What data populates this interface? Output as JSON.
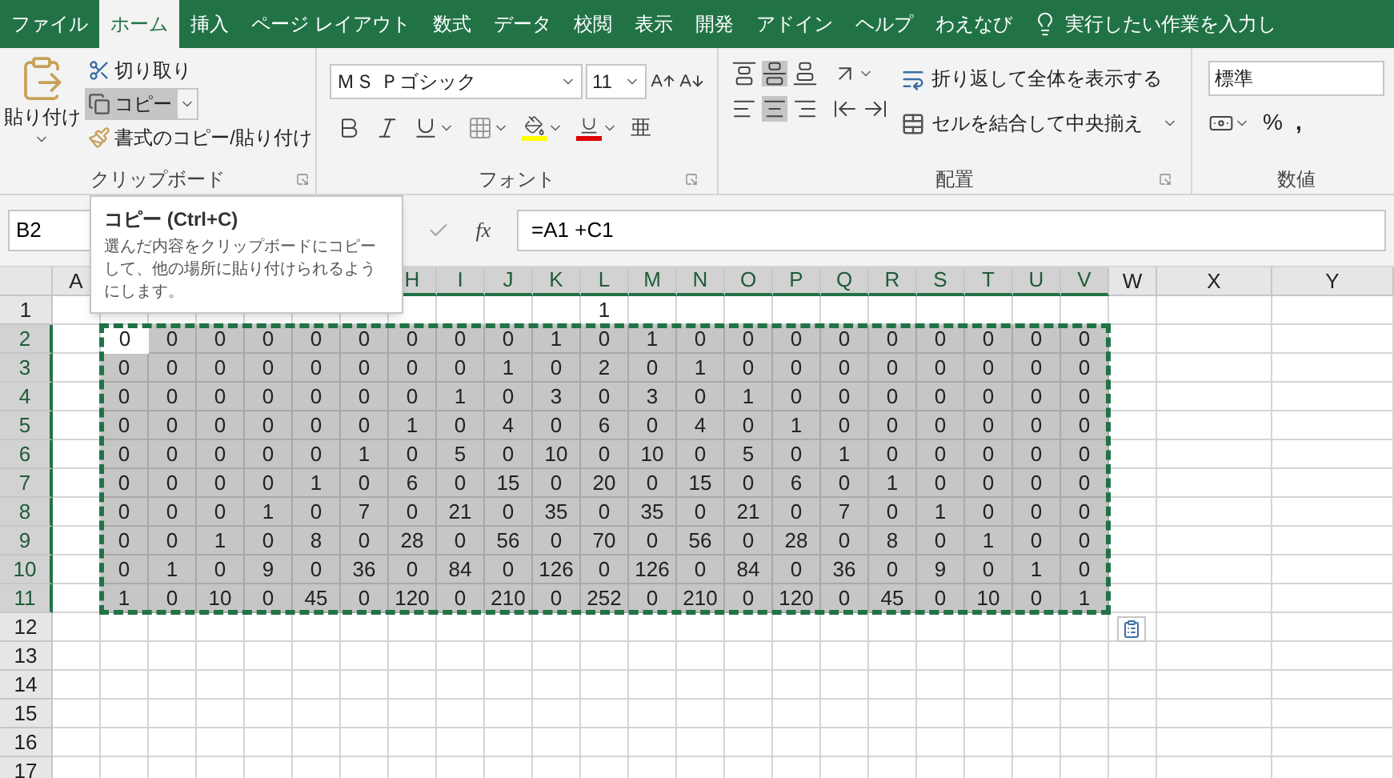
{
  "ribbon_tabs": [
    {
      "label": "ファイル",
      "selected": false
    },
    {
      "label": "ホーム",
      "selected": true
    },
    {
      "label": "挿入",
      "selected": false
    },
    {
      "label": "ページ レイアウト",
      "selected": false
    },
    {
      "label": "数式",
      "selected": false
    },
    {
      "label": "データ",
      "selected": false
    },
    {
      "label": "校閲",
      "selected": false
    },
    {
      "label": "表示",
      "selected": false
    },
    {
      "label": "開発",
      "selected": false
    },
    {
      "label": "アドイン",
      "selected": false
    },
    {
      "label": "ヘルプ",
      "selected": false
    },
    {
      "label": "わえなび",
      "selected": false
    }
  ],
  "tell_me": {
    "placeholder": "実行したい作業を入力し"
  },
  "clipboard": {
    "paste": "貼り付け",
    "cut": "切り取り",
    "copy": {
      "label": "コピー",
      "selected": true
    },
    "format_painter": "書式のコピー/貼り付け",
    "group_label": "クリップボード"
  },
  "font": {
    "name": "ＭＳ Ｐゴシック",
    "size": "11",
    "phonetic": "亜",
    "group_label": "フォント"
  },
  "alignment": {
    "wrap": "折り返して全体を表示する",
    "merge": "セルを結合して中央揃え",
    "group_label": "配置"
  },
  "number": {
    "format": "標準",
    "percent": "%",
    "comma": ",",
    "group_label": "数値"
  },
  "formula_bar": {
    "name_box": "B2",
    "fx": "fx",
    "formula": "=A1 +C1"
  },
  "tooltip": {
    "title": "コピー (Ctrl+C)",
    "body": "選んだ内容をクリップボードにコピーして、他の場所に貼り付けられるようにします。"
  },
  "sheet": {
    "columns": [
      {
        "letter": "A",
        "selected": false,
        "active": false
      },
      {
        "selected": true,
        "active": true
      },
      {
        "selected": true,
        "active": false
      },
      {
        "selected": true,
        "active": false
      },
      {
        "selected": true,
        "active": false
      },
      {
        "selected": true,
        "active": false
      },
      {
        "selected": true,
        "active": false
      },
      {
        "letter": "H",
        "selected": true,
        "active": false
      },
      {
        "letter": "I",
        "selected": true,
        "active": false
      },
      {
        "letter": "J",
        "selected": true,
        "active": false
      },
      {
        "letter": "K",
        "selected": true,
        "active": false
      },
      {
        "letter": "L",
        "selected": true,
        "active": false
      },
      {
        "letter": "M",
        "selected": true,
        "active": false
      },
      {
        "letter": "N",
        "selected": true,
        "active": false
      },
      {
        "letter": "O",
        "selected": true,
        "active": false
      },
      {
        "letter": "P",
        "selected": true,
        "active": false
      },
      {
        "letter": "Q",
        "selected": true,
        "active": false
      },
      {
        "letter": "R",
        "selected": true,
        "active": false
      },
      {
        "letter": "S",
        "selected": true,
        "active": false
      },
      {
        "letter": "T",
        "selected": true,
        "active": false
      },
      {
        "letter": "U",
        "selected": true,
        "active": false
      },
      {
        "letter": "V",
        "selected": true,
        "active": false
      },
      {
        "letter": "W",
        "selected": false,
        "active": false
      },
      {
        "letter": "X",
        "selected": false,
        "active": false
      },
      {
        "letter": "Y",
        "selected": false,
        "active": false
      }
    ],
    "rows": [
      {
        "number": "1",
        "selected": false,
        "active": false,
        "cells": [
          null,
          null,
          null,
          null,
          null,
          null,
          null,
          null,
          null,
          null,
          null,
          "1",
          null,
          null,
          null,
          null,
          null,
          null,
          null,
          null,
          null,
          null,
          null,
          null,
          null
        ]
      },
      {
        "number": "2",
        "selected": true,
        "active": true,
        "cells": [
          null,
          "0",
          "0",
          "0",
          "0",
          "0",
          "0",
          "0",
          "0",
          "0",
          "1",
          "0",
          "1",
          "0",
          "0",
          "0",
          "0",
          "0",
          "0",
          "0",
          "0",
          "0",
          null,
          null,
          null
        ]
      },
      {
        "number": "3",
        "selected": true,
        "active": false,
        "cells": [
          null,
          "0",
          "0",
          "0",
          "0",
          "0",
          "0",
          "0",
          "0",
          "1",
          "0",
          "2",
          "0",
          "1",
          "0",
          "0",
          "0",
          "0",
          "0",
          "0",
          "0",
          "0",
          null,
          null,
          null
        ]
      },
      {
        "number": "4",
        "selected": true,
        "active": false,
        "cells": [
          null,
          "0",
          "0",
          "0",
          "0",
          "0",
          "0",
          "0",
          "1",
          "0",
          "3",
          "0",
          "3",
          "0",
          "1",
          "0",
          "0",
          "0",
          "0",
          "0",
          "0",
          "0",
          null,
          null,
          null
        ]
      },
      {
        "number": "5",
        "selected": true,
        "active": false,
        "cells": [
          null,
          "0",
          "0",
          "0",
          "0",
          "0",
          "0",
          "1",
          "0",
          "4",
          "0",
          "6",
          "0",
          "4",
          "0",
          "1",
          "0",
          "0",
          "0",
          "0",
          "0",
          "0",
          null,
          null,
          null
        ]
      },
      {
        "number": "6",
        "selected": true,
        "active": false,
        "cells": [
          null,
          "0",
          "0",
          "0",
          "0",
          "0",
          "1",
          "0",
          "5",
          "0",
          "10",
          "0",
          "10",
          "0",
          "5",
          "0",
          "1",
          "0",
          "0",
          "0",
          "0",
          "0",
          null,
          null,
          null
        ]
      },
      {
        "number": "7",
        "selected": true,
        "active": false,
        "cells": [
          null,
          "0",
          "0",
          "0",
          "0",
          "1",
          "0",
          "6",
          "0",
          "15",
          "0",
          "20",
          "0",
          "15",
          "0",
          "6",
          "0",
          "1",
          "0",
          "0",
          "0",
          "0",
          null,
          null,
          null
        ]
      },
      {
        "number": "8",
        "selected": true,
        "active": false,
        "cells": [
          null,
          "0",
          "0",
          "0",
          "1",
          "0",
          "7",
          "0",
          "21",
          "0",
          "35",
          "0",
          "35",
          "0",
          "21",
          "0",
          "7",
          "0",
          "1",
          "0",
          "0",
          "0",
          null,
          null,
          null
        ]
      },
      {
        "number": "9",
        "selected": true,
        "active": false,
        "cells": [
          null,
          "0",
          "0",
          "1",
          "0",
          "8",
          "0",
          "28",
          "0",
          "56",
          "0",
          "70",
          "0",
          "56",
          "0",
          "28",
          "0",
          "8",
          "0",
          "1",
          "0",
          "0",
          null,
          null,
          null
        ]
      },
      {
        "number": "10",
        "selected": true,
        "active": false,
        "cells": [
          null,
          "0",
          "1",
          "0",
          "9",
          "0",
          "36",
          "0",
          "84",
          "0",
          "126",
          "0",
          "126",
          "0",
          "84",
          "0",
          "36",
          "0",
          "9",
          "0",
          "1",
          "0",
          null,
          null,
          null
        ]
      },
      {
        "number": "11",
        "selected": true,
        "active": false,
        "cells": [
          null,
          "1",
          "0",
          "10",
          "0",
          "45",
          "0",
          "120",
          "0",
          "210",
          "0",
          "252",
          "0",
          "210",
          "0",
          "120",
          "0",
          "45",
          "0",
          "10",
          "0",
          "1",
          null,
          null,
          null
        ]
      },
      {
        "number": "12",
        "selected": false,
        "active": false
      },
      {
        "number": "13",
        "selected": false,
        "active": false
      },
      {
        "number": "14",
        "selected": false,
        "active": false
      },
      {
        "number": "15",
        "selected": false,
        "active": false
      },
      {
        "number": "16",
        "selected": false,
        "active": false
      },
      {
        "number": "17",
        "selected": false,
        "active": false
      }
    ]
  }
}
